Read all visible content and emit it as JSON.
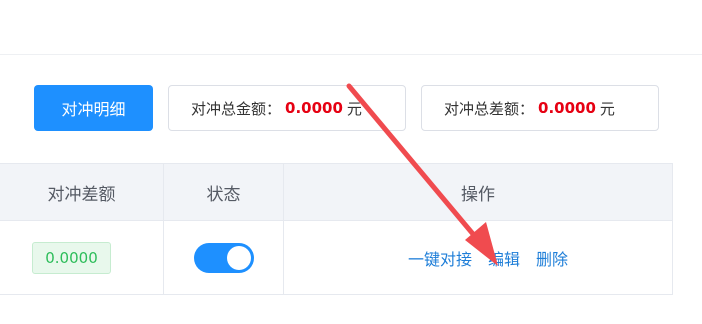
{
  "toolbar": {
    "detail_button_label": "对冲明细",
    "total_amount": {
      "label": "对冲总金额：",
      "value": "0.0000",
      "unit": "元"
    },
    "total_diff": {
      "label": "对冲总差额：",
      "value": "0.0000",
      "unit": "元"
    }
  },
  "table": {
    "columns": [
      "对冲差额",
      "状态",
      "操作"
    ],
    "rows": [
      {
        "diff_amount": "0.0000",
        "status_on": true,
        "actions": [
          "一键对接",
          "编辑",
          "删除"
        ]
      }
    ]
  },
  "colors": {
    "primary": "#1e90ff",
    "amount_red": "#e60012",
    "success_green": "#2dbd5a",
    "annotation_arrow": "#f04b4f"
  }
}
